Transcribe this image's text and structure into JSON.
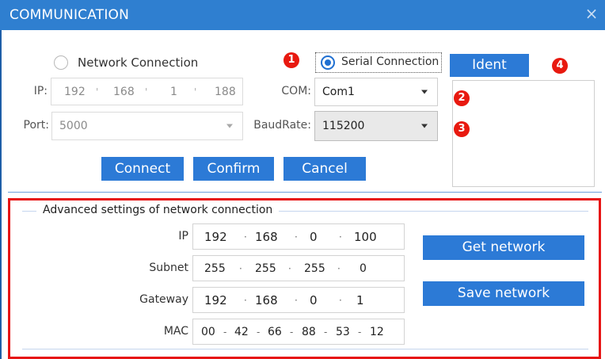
{
  "window": {
    "title": "COMMUNICATION",
    "close_glyph": "×"
  },
  "connection": {
    "network_label": "Network Connection",
    "network_selected": false,
    "serial_label": "Serial Connection",
    "serial_selected": true,
    "ip_label": "IP:",
    "ip": [
      "192",
      "168",
      "1",
      "188"
    ],
    "port_label": "Port:",
    "port_value": "5000",
    "com_label": "COM:",
    "com_value": "Com1",
    "baud_label": "BaudRate:",
    "baud_value": "115200"
  },
  "ident": {
    "button_label": "Ident"
  },
  "actions": {
    "connect": "Connect",
    "confirm": "Confirm",
    "cancel": "Cancel"
  },
  "markers": [
    "1",
    "2",
    "3",
    "4"
  ],
  "marker_color": "#e8190f",
  "accent_color": "#2c7ad6",
  "advanced": {
    "group_title": "Advanced settings of network connection",
    "ip_label": "IP",
    "ip": [
      "192",
      "168",
      "0",
      "100"
    ],
    "subnet_label": "Subnet",
    "subnet": [
      "255",
      "255",
      "255",
      "0"
    ],
    "gateway_label": "Gateway",
    "gateway": [
      "192",
      "168",
      "0",
      "1"
    ],
    "mac_label": "MAC",
    "mac": [
      "00",
      "42",
      "66",
      "88",
      "53",
      "12"
    ],
    "get_network": "Get network",
    "save_network": "Save network"
  }
}
